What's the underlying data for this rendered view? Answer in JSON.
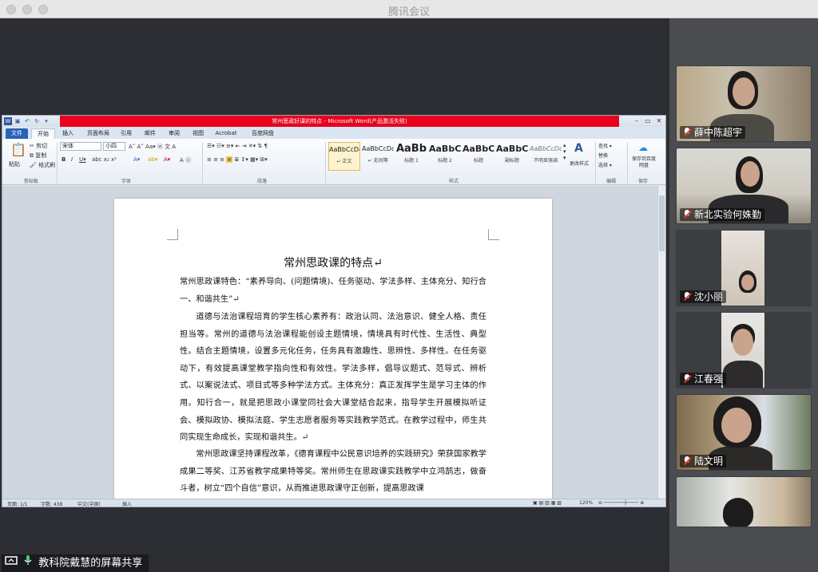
{
  "app": {
    "title": "腾讯会议"
  },
  "word": {
    "window_title": "常州思政好课的特点 - Microsoft Word(产品激活失败)",
    "tabs": [
      "文件",
      "开始",
      "插入",
      "页面布局",
      "引用",
      "邮件",
      "审阅",
      "视图",
      "Acrobat",
      "百度网盘"
    ],
    "clipboard": {
      "paste": "粘贴",
      "cut": "剪切",
      "copy": "复制",
      "format_painter": "格式刷",
      "label": "剪贴板"
    },
    "font": {
      "name": "宋体",
      "size": "小四",
      "label": "字体"
    },
    "paragraph_label": "段落",
    "styles": [
      {
        "sample": "AaBbCcDd",
        "name": "↵ 正文"
      },
      {
        "sample": "AaBbCcDd",
        "name": "↵ 无间隔"
      },
      {
        "sample": "AaBb",
        "name": "标题 1"
      },
      {
        "sample": "AaBbC",
        "name": "标题 2"
      },
      {
        "sample": "AaBbC",
        "name": "标题"
      },
      {
        "sample": "AaBbC",
        "name": "副标题"
      },
      {
        "sample": "AaBbCcDd",
        "name": "不明显强调"
      }
    ],
    "styles_label": "样式",
    "change_styles": "更改样式",
    "editing": {
      "find": "查找 ▾",
      "replace": "替换",
      "select": "选择 ▾",
      "label": "编辑"
    },
    "save_to_baidu": "保存到百度网盘",
    "save_label": "保存",
    "document": {
      "title": "常州思政课的特点↵",
      "p1": "常州思政课特色：“素养导向、(问题情境)、任务驱动、学法多样、主体充分、知行合一、和谐共生”↵",
      "p2": "道德与法治课程培育的学生核心素养有：政治认同、法治意识、健全人格、责任担当等。常州的道德与法治课程能创设主题情境，情境具有时代性、生活性、典型性。结合主题情境，设置多元化任务，任务具有激趣性、思辨性、多样性。在任务驱动下，有效提高课堂教学指向性和有效性。学法多样，倡导议题式、范导式、辨析式、以案说法式、项目式等多种学法方式。主体充分：真正发挥学生是学习主体的作用。知行合一，就是把思政小课堂同社会大课堂结合起来，指导学生开展模拟听证会、模拟政协、模拟法庭、学生志愿者服务等实践教学范式。在教学过程中，师生共同实现生命成长，实现和谐共生。↵",
      "p3": "常州思政课坚持课程改革，《德育课程中公民意识培养的实践研究》荣获国家教学成果二等奖、江苏省教学成果特等奖。常州师生在思政课实践教学中立鸿鹄志，做奋斗者，树立“四个自信”意识，从而推进思政课守正创新，提高思政课"
    },
    "status": {
      "page": "页面: 1/1",
      "words": "字数: 438",
      "lang": "中文(中国)",
      "mode": "插入",
      "zoom": "120%"
    }
  },
  "participants": [
    {
      "name": "薛中陈超宇",
      "muted": true
    },
    {
      "name": "新北实验何姝勤",
      "muted": true
    },
    {
      "name": "沈小丽",
      "muted": true
    },
    {
      "name": "江春强",
      "muted": true
    },
    {
      "name": "陆文明",
      "muted": true
    },
    {
      "name": "",
      "muted": false
    }
  ],
  "share_label": "教科院戴慧的屏幕共享",
  "colors": {
    "word_red": "#e8001c",
    "file_tab": "#2a62b6",
    "panel_bg": "#4a4c50"
  }
}
